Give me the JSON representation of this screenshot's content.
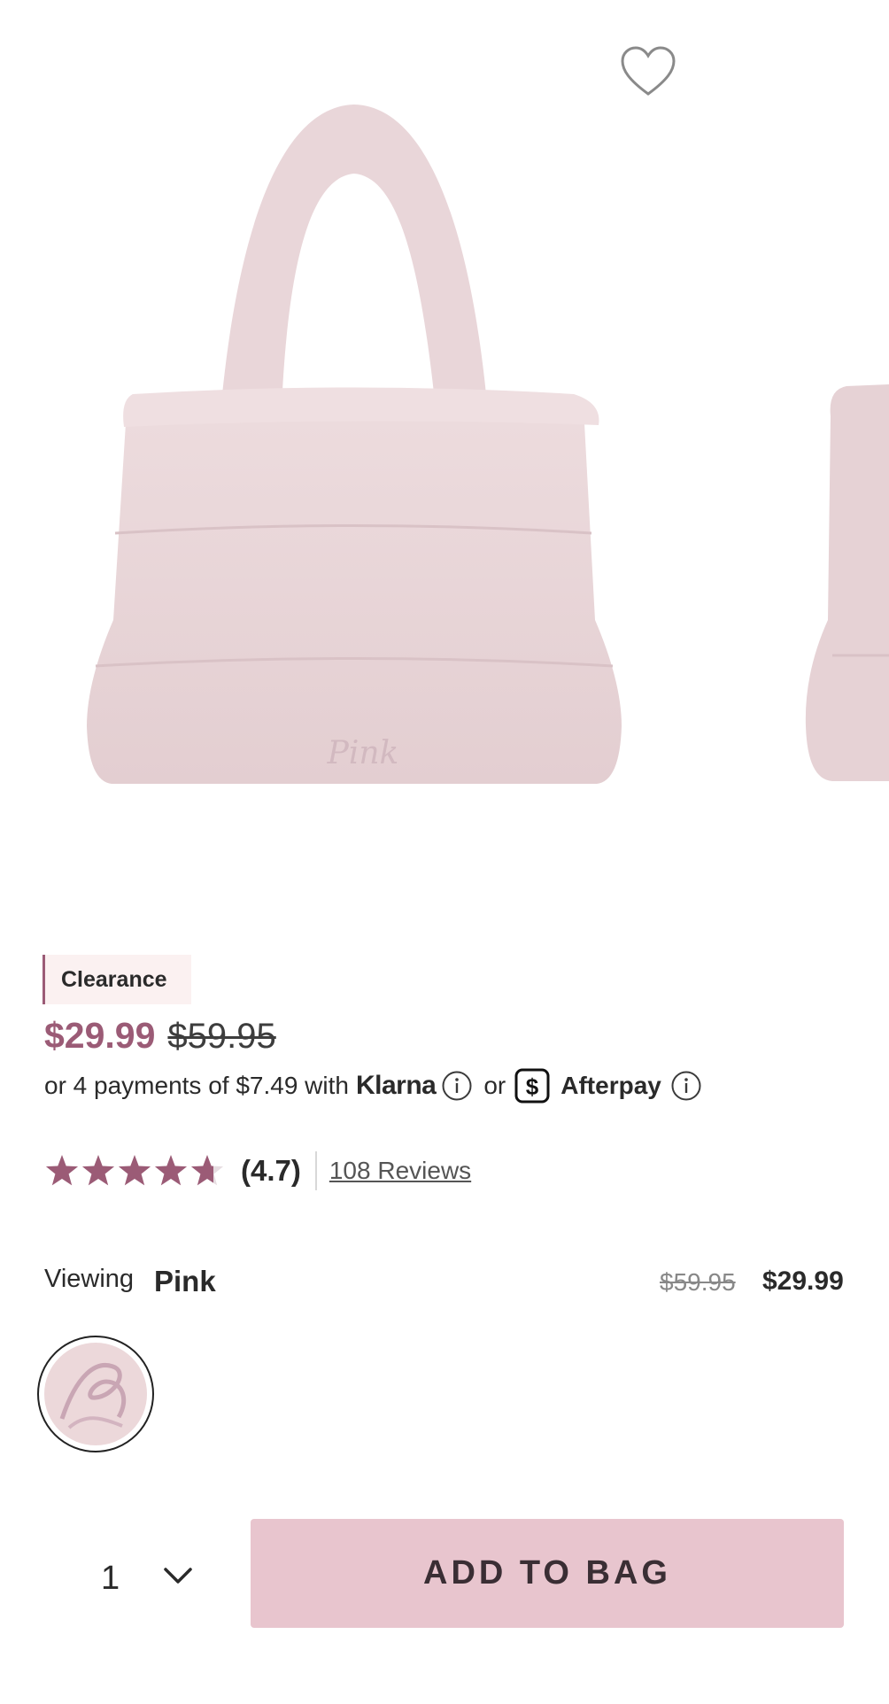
{
  "gallery": {
    "image_alt": "Pink sherpa puffer tote bag",
    "bag_embroidery": "Pink",
    "progress": 0.333,
    "wishlist_icon": "heart-outline-icon"
  },
  "product": {
    "badge": "Clearance",
    "sale_price": "$29.99",
    "original_price": "$59.95",
    "payments_text": "or 4 payments of $7.49 with",
    "klarna_label": "Klarna",
    "or_text": "or",
    "afterpay_label": "Afterpay",
    "rating_value": 4.7,
    "rating_text": "(4.7)",
    "reviews_label": "108 Reviews"
  },
  "variant": {
    "viewing_label": "Viewing",
    "selected_color": "Pink",
    "original_price": "$59.95",
    "sale_price": "$29.99"
  },
  "purchase": {
    "quantity": "1",
    "add_to_bag_label": "ADD TO BAG"
  },
  "colors": {
    "accent": "#9b5b76",
    "button": "#e8c5ce",
    "bag": "#e7d4d6",
    "badge_bg": "#fbf1f1"
  }
}
